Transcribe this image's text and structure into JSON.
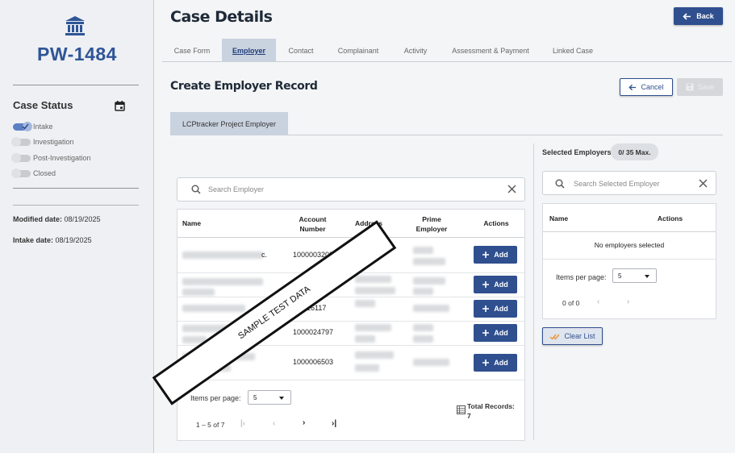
{
  "sidebar": {
    "case_id": "PW-1484",
    "case_status_title": "Case Status",
    "statuses": [
      {
        "label": "Intake",
        "on": true
      },
      {
        "label": "Investigation",
        "on": false
      },
      {
        "label": "Post-Investigation",
        "on": false
      },
      {
        "label": "Closed",
        "on": false
      }
    ],
    "modified_label": "Modified date:",
    "modified_value": "08/19/2025",
    "intake_label": "Intake date:",
    "intake_value": "08/19/2025"
  },
  "header": {
    "title": "Case Details",
    "back_label": "Back"
  },
  "tabs": [
    "Case Form",
    "Employer",
    "Contact",
    "Complainant",
    "Activity",
    "Assessment & Payment",
    "Linked Case"
  ],
  "active_tab": "Employer",
  "form": {
    "title": "Create Employer Record",
    "cancel_label": "Cancel",
    "save_label": "Save",
    "subtab_label": "LCPtracker Project Employer"
  },
  "employer_search": {
    "placeholder": "Search Employer",
    "columns": {
      "name": "Name",
      "account": "Account Number",
      "address": "Address",
      "prime": "Prime Employer",
      "actions": "Actions"
    },
    "rows": [
      {
        "name_suffix": "c.",
        "account": "1000003208",
        "add_label": "Add"
      },
      {
        "name_suffix": "",
        "account": "",
        "add_label": "Add"
      },
      {
        "name_suffix": "",
        "account": "16117",
        "add_label": "Add"
      },
      {
        "name_suffix": "",
        "account": "1000024797",
        "add_label": "Add"
      },
      {
        "name_suffix": "",
        "account": "1000006503",
        "add_label": "Add"
      }
    ],
    "items_per_page_label": "Items per page:",
    "items_per_page": "5",
    "range": "1 – 5 of 7",
    "total_label": "Total Records:",
    "total_value": "7"
  },
  "selected": {
    "label": "Selected Employers:",
    "badge": "0/ 35 Max.",
    "placeholder": "Search Selected Employer",
    "col_name": "Name",
    "col_actions": "Actions",
    "empty": "No employers selected",
    "items_per_page_label": "Items per page:",
    "items_per_page": "5",
    "range": "0 of 0",
    "clear_label": "Clear List"
  },
  "watermark": "SAMPLE TEST DATA",
  "colors": {
    "primary": "#2f4f8f",
    "brand": "#2f5597",
    "tab_active_bg": "#c9d2df"
  }
}
